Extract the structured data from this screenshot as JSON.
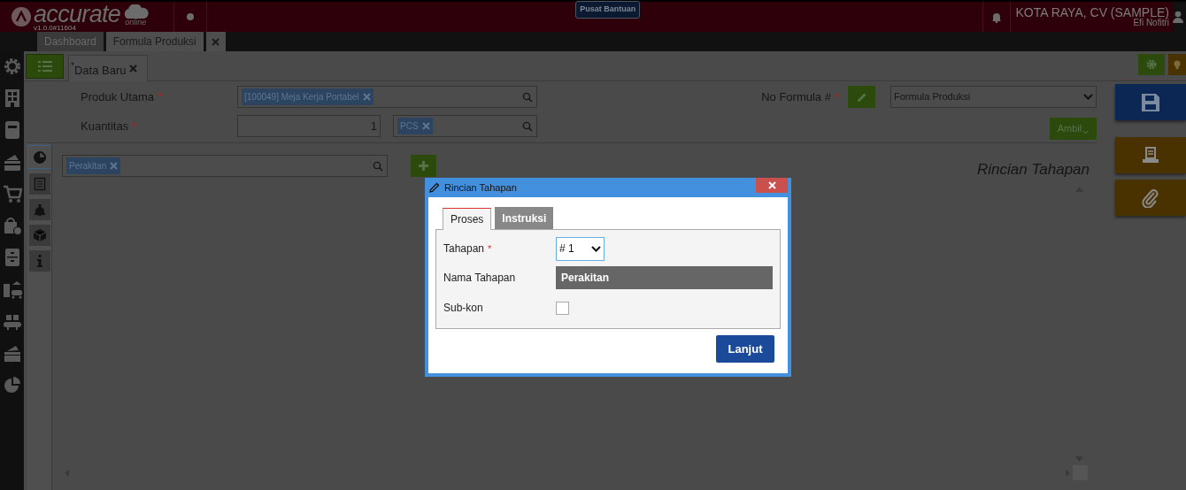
{
  "header": {
    "logo_text": "accurate",
    "logo_sub": "online",
    "version": "v1.0.0#11604",
    "help_button": "Pusat Bantuan",
    "company": "KOTA RAYA, CV (SAMPLE)",
    "user": "Efi Nofitri"
  },
  "tabs": [
    {
      "label": "Dashboard",
      "selected": false
    },
    {
      "label": "Formula Produksi",
      "selected": true
    }
  ],
  "doc_tab": {
    "label": "Data Baru",
    "unsaved_mark": "*"
  },
  "form": {
    "produk_utama": {
      "label": "Produk Utama",
      "required_mark": "*",
      "tag": "[100049] Meja Kerja Portabel"
    },
    "kuantitas": {
      "label": "Kuantitas",
      "required_mark": "*",
      "value": "1",
      "unit_tag": "PCS"
    },
    "no_formula": {
      "label": "No Formula #",
      "required_mark": "*",
      "value": "Formula Produksi"
    },
    "ambil_button": "Ambil"
  },
  "side_tabs": [
    {
      "selected": true
    },
    {
      "selected": false
    },
    {
      "selected": false
    },
    {
      "selected": false
    },
    {
      "selected": false
    }
  ],
  "stage_filter": {
    "tag": "Perakitan"
  },
  "panel_title": "Rincian Tahapan",
  "dialog": {
    "title": "Rincian Tahapan",
    "tabs": [
      {
        "label": "Proses",
        "selected": true
      },
      {
        "label": "Instruksi",
        "selected": false
      }
    ],
    "tahapan": {
      "label": "Tahapan",
      "required_mark": "*",
      "value": "# 1"
    },
    "nama_tahapan": {
      "label": "Nama Tahapan",
      "value": "Perakitan"
    },
    "sub_kon": {
      "label": "Sub-kon",
      "checked": false
    },
    "button": "Lanjut"
  }
}
